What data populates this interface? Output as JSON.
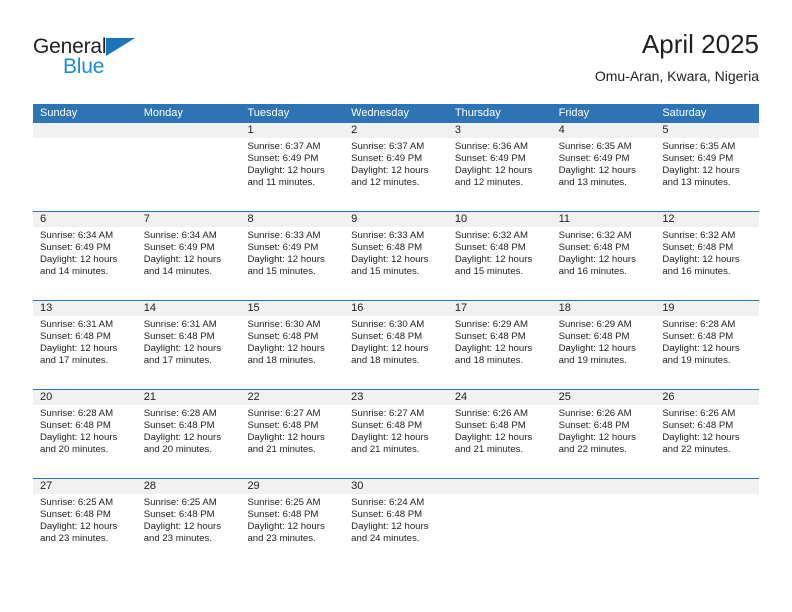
{
  "brand": {
    "name_top": "General",
    "name_bottom": "Blue",
    "triangle_color": "#1b75bb",
    "blue_color": "#1b8fd4"
  },
  "header": {
    "title": "April 2025",
    "subtitle": "Omu-Aran, Kwara, Nigeria"
  },
  "theme": {
    "header_blue": "#2e74b5",
    "band_gray": "#f1f1f1",
    "text": "#231f20"
  },
  "weekdays": [
    "Sunday",
    "Monday",
    "Tuesday",
    "Wednesday",
    "Thursday",
    "Friday",
    "Saturday"
  ],
  "weeks": [
    [
      {
        "day": "",
        "sunrise": "",
        "sunset": "",
        "daylight1": "",
        "daylight2": ""
      },
      {
        "day": "",
        "sunrise": "",
        "sunset": "",
        "daylight1": "",
        "daylight2": ""
      },
      {
        "day": "1",
        "sunrise": "Sunrise: 6:37 AM",
        "sunset": "Sunset: 6:49 PM",
        "daylight1": "Daylight: 12 hours",
        "daylight2": "and 11 minutes."
      },
      {
        "day": "2",
        "sunrise": "Sunrise: 6:37 AM",
        "sunset": "Sunset: 6:49 PM",
        "daylight1": "Daylight: 12 hours",
        "daylight2": "and 12 minutes."
      },
      {
        "day": "3",
        "sunrise": "Sunrise: 6:36 AM",
        "sunset": "Sunset: 6:49 PM",
        "daylight1": "Daylight: 12 hours",
        "daylight2": "and 12 minutes."
      },
      {
        "day": "4",
        "sunrise": "Sunrise: 6:35 AM",
        "sunset": "Sunset: 6:49 PM",
        "daylight1": "Daylight: 12 hours",
        "daylight2": "and 13 minutes."
      },
      {
        "day": "5",
        "sunrise": "Sunrise: 6:35 AM",
        "sunset": "Sunset: 6:49 PM",
        "daylight1": "Daylight: 12 hours",
        "daylight2": "and 13 minutes."
      }
    ],
    [
      {
        "day": "6",
        "sunrise": "Sunrise: 6:34 AM",
        "sunset": "Sunset: 6:49 PM",
        "daylight1": "Daylight: 12 hours",
        "daylight2": "and 14 minutes."
      },
      {
        "day": "7",
        "sunrise": "Sunrise: 6:34 AM",
        "sunset": "Sunset: 6:49 PM",
        "daylight1": "Daylight: 12 hours",
        "daylight2": "and 14 minutes."
      },
      {
        "day": "8",
        "sunrise": "Sunrise: 6:33 AM",
        "sunset": "Sunset: 6:49 PM",
        "daylight1": "Daylight: 12 hours",
        "daylight2": "and 15 minutes."
      },
      {
        "day": "9",
        "sunrise": "Sunrise: 6:33 AM",
        "sunset": "Sunset: 6:48 PM",
        "daylight1": "Daylight: 12 hours",
        "daylight2": "and 15 minutes."
      },
      {
        "day": "10",
        "sunrise": "Sunrise: 6:32 AM",
        "sunset": "Sunset: 6:48 PM",
        "daylight1": "Daylight: 12 hours",
        "daylight2": "and 15 minutes."
      },
      {
        "day": "11",
        "sunrise": "Sunrise: 6:32 AM",
        "sunset": "Sunset: 6:48 PM",
        "daylight1": "Daylight: 12 hours",
        "daylight2": "and 16 minutes."
      },
      {
        "day": "12",
        "sunrise": "Sunrise: 6:32 AM",
        "sunset": "Sunset: 6:48 PM",
        "daylight1": "Daylight: 12 hours",
        "daylight2": "and 16 minutes."
      }
    ],
    [
      {
        "day": "13",
        "sunrise": "Sunrise: 6:31 AM",
        "sunset": "Sunset: 6:48 PM",
        "daylight1": "Daylight: 12 hours",
        "daylight2": "and 17 minutes."
      },
      {
        "day": "14",
        "sunrise": "Sunrise: 6:31 AM",
        "sunset": "Sunset: 6:48 PM",
        "daylight1": "Daylight: 12 hours",
        "daylight2": "and 17 minutes."
      },
      {
        "day": "15",
        "sunrise": "Sunrise: 6:30 AM",
        "sunset": "Sunset: 6:48 PM",
        "daylight1": "Daylight: 12 hours",
        "daylight2": "and 18 minutes."
      },
      {
        "day": "16",
        "sunrise": "Sunrise: 6:30 AM",
        "sunset": "Sunset: 6:48 PM",
        "daylight1": "Daylight: 12 hours",
        "daylight2": "and 18 minutes."
      },
      {
        "day": "17",
        "sunrise": "Sunrise: 6:29 AM",
        "sunset": "Sunset: 6:48 PM",
        "daylight1": "Daylight: 12 hours",
        "daylight2": "and 18 minutes."
      },
      {
        "day": "18",
        "sunrise": "Sunrise: 6:29 AM",
        "sunset": "Sunset: 6:48 PM",
        "daylight1": "Daylight: 12 hours",
        "daylight2": "and 19 minutes."
      },
      {
        "day": "19",
        "sunrise": "Sunrise: 6:28 AM",
        "sunset": "Sunset: 6:48 PM",
        "daylight1": "Daylight: 12 hours",
        "daylight2": "and 19 minutes."
      }
    ],
    [
      {
        "day": "20",
        "sunrise": "Sunrise: 6:28 AM",
        "sunset": "Sunset: 6:48 PM",
        "daylight1": "Daylight: 12 hours",
        "daylight2": "and 20 minutes."
      },
      {
        "day": "21",
        "sunrise": "Sunrise: 6:28 AM",
        "sunset": "Sunset: 6:48 PM",
        "daylight1": "Daylight: 12 hours",
        "daylight2": "and 20 minutes."
      },
      {
        "day": "22",
        "sunrise": "Sunrise: 6:27 AM",
        "sunset": "Sunset: 6:48 PM",
        "daylight1": "Daylight: 12 hours",
        "daylight2": "and 21 minutes."
      },
      {
        "day": "23",
        "sunrise": "Sunrise: 6:27 AM",
        "sunset": "Sunset: 6:48 PM",
        "daylight1": "Daylight: 12 hours",
        "daylight2": "and 21 minutes."
      },
      {
        "day": "24",
        "sunrise": "Sunrise: 6:26 AM",
        "sunset": "Sunset: 6:48 PM",
        "daylight1": "Daylight: 12 hours",
        "daylight2": "and 21 minutes."
      },
      {
        "day": "25",
        "sunrise": "Sunrise: 6:26 AM",
        "sunset": "Sunset: 6:48 PM",
        "daylight1": "Daylight: 12 hours",
        "daylight2": "and 22 minutes."
      },
      {
        "day": "26",
        "sunrise": "Sunrise: 6:26 AM",
        "sunset": "Sunset: 6:48 PM",
        "daylight1": "Daylight: 12 hours",
        "daylight2": "and 22 minutes."
      }
    ],
    [
      {
        "day": "27",
        "sunrise": "Sunrise: 6:25 AM",
        "sunset": "Sunset: 6:48 PM",
        "daylight1": "Daylight: 12 hours",
        "daylight2": "and 23 minutes."
      },
      {
        "day": "28",
        "sunrise": "Sunrise: 6:25 AM",
        "sunset": "Sunset: 6:48 PM",
        "daylight1": "Daylight: 12 hours",
        "daylight2": "and 23 minutes."
      },
      {
        "day": "29",
        "sunrise": "Sunrise: 6:25 AM",
        "sunset": "Sunset: 6:48 PM",
        "daylight1": "Daylight: 12 hours",
        "daylight2": "and 23 minutes."
      },
      {
        "day": "30",
        "sunrise": "Sunrise: 6:24 AM",
        "sunset": "Sunset: 6:48 PM",
        "daylight1": "Daylight: 12 hours",
        "daylight2": "and 24 minutes."
      },
      {
        "day": "",
        "sunrise": "",
        "sunset": "",
        "daylight1": "",
        "daylight2": ""
      },
      {
        "day": "",
        "sunrise": "",
        "sunset": "",
        "daylight1": "",
        "daylight2": ""
      },
      {
        "day": "",
        "sunrise": "",
        "sunset": "",
        "daylight1": "",
        "daylight2": ""
      }
    ]
  ]
}
